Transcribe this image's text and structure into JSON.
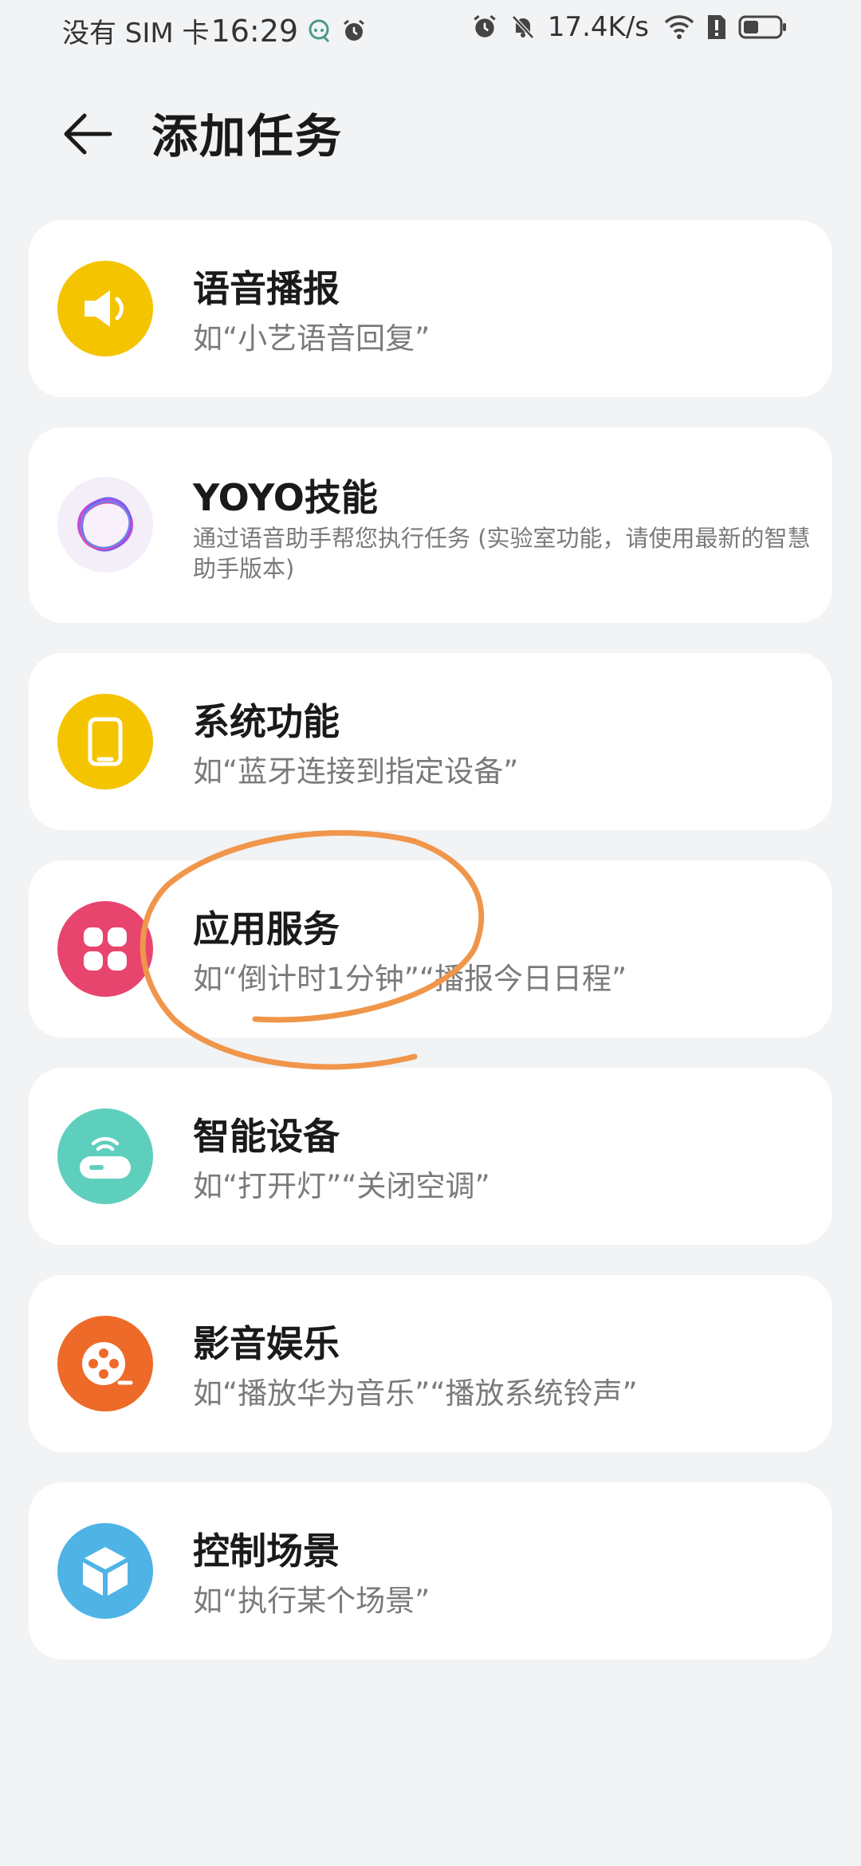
{
  "status_bar": {
    "carrier": "没有 SIM 卡",
    "time": "16:29",
    "speed": "17.4K/s"
  },
  "header": {
    "title": "添加任务"
  },
  "cards": [
    {
      "title": "语音播报",
      "desc": "如“小艺语音回复”",
      "icon": "speaker-icon",
      "color": "#f5c400"
    },
    {
      "title": "YOYO技能",
      "desc": "通过语音助手帮您执行任务 (实验室功能，请使用最新的智慧助手版本)",
      "icon": "yoyo-orb-icon",
      "color": "#f3eef8"
    },
    {
      "title": "系统功能",
      "desc": "如“蓝牙连接到指定设备”",
      "icon": "phone-icon",
      "color": "#f5c400"
    },
    {
      "title": "应用服务",
      "desc": "如“倒计时1分钟”“播报今日日程”",
      "icon": "apps-grid-icon",
      "color": "#e8456e"
    },
    {
      "title": "智能设备",
      "desc": "如“打开灯”“关闭空调”",
      "icon": "smart-device-icon",
      "color": "#5fcfbd"
    },
    {
      "title": "影音娱乐",
      "desc": "如“播放华为音乐”“播放系统铃声”",
      "icon": "film-reel-icon",
      "color": "#ee6a28"
    },
    {
      "title": "控制场景",
      "desc": "如“执行某个场景”",
      "icon": "cube-icon",
      "color": "#4fb3e6"
    }
  ],
  "annotation": {
    "color": "#f0964a"
  }
}
